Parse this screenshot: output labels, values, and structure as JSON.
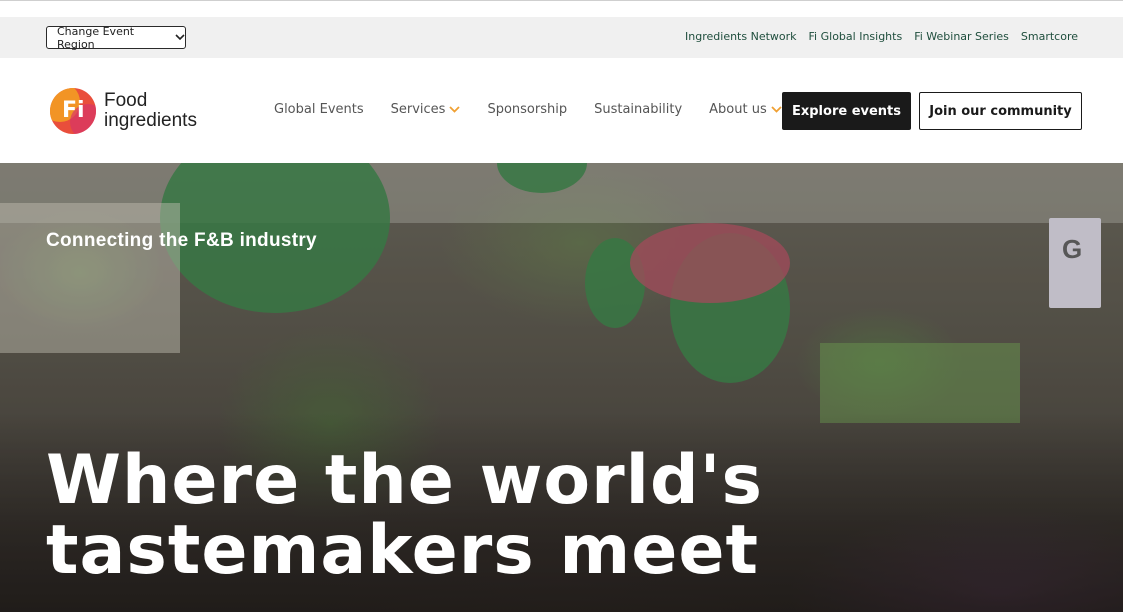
{
  "utility_bar": {
    "region_button_label": "Change Event Region",
    "links": [
      "Ingredients Network",
      "Fi Global Insights",
      "Fi Webinar Series",
      "Smartcore"
    ]
  },
  "logo": {
    "mark": "Fi",
    "line1": "Food",
    "line2": "ingredients"
  },
  "nav": {
    "items": [
      {
        "label": "Global Events",
        "has_dropdown": false
      },
      {
        "label": "Services",
        "has_dropdown": true
      },
      {
        "label": "Sponsorship",
        "has_dropdown": false
      },
      {
        "label": "Sustainability",
        "has_dropdown": false
      },
      {
        "label": "About us",
        "has_dropdown": true
      }
    ],
    "explore_button": "Explore events",
    "join_button": "Join our community"
  },
  "hero": {
    "tagline": "Connecting the F&B industry",
    "headline": "Where the world's tastemakers meet",
    "sign_letter": "G"
  },
  "colors": {
    "dropdown_chevron": "#f0a033",
    "primary_button": "#1a1a1a",
    "utility_link": "#1f4e3d"
  }
}
